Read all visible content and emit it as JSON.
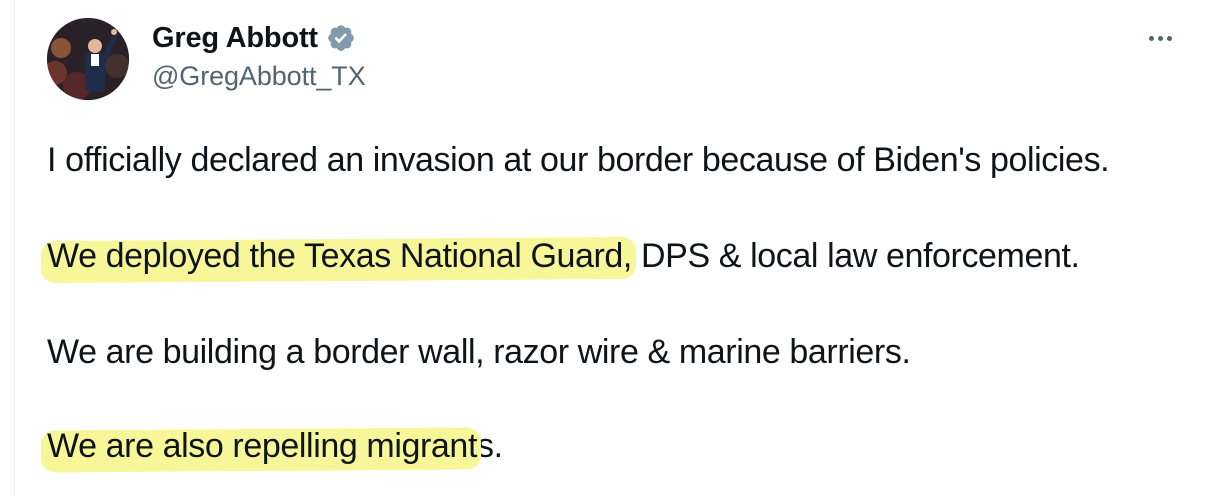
{
  "tweet": {
    "author": {
      "display_name": "Greg Abbott",
      "handle": "@GregAbbott_TX",
      "verified_icon": "verified-badge-icon",
      "verified_color": "#829aab"
    },
    "more_icon": "more-horizontal-icon",
    "paragraphs": [
      {
        "plain": "I officially declared an invasion at our border because of Biden's policies."
      },
      {
        "highlighted": "We deployed the Texas National Guard,",
        "rest": " DPS & local law enforcement."
      },
      {
        "plain": "We are building a border wall, razor wire & marine barriers."
      },
      {
        "highlighted": "We are also repelling migrant",
        "rest": "s."
      }
    ],
    "highlight_color": "#f7f79a"
  }
}
